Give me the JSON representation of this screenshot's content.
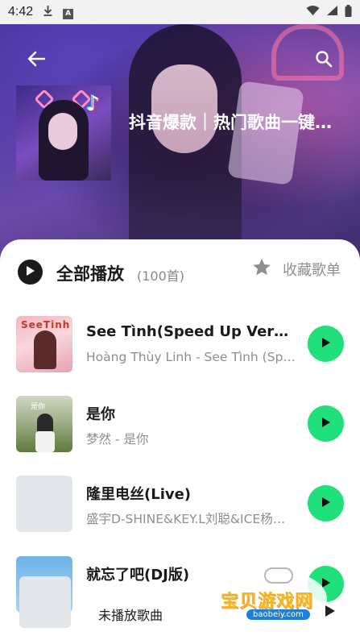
{
  "status_bar": {
    "time": "4:42",
    "icons": [
      "download-icon",
      "a-icon",
      "wifi-icon",
      "signal-icon",
      "battery-icon"
    ]
  },
  "header": {
    "playlist_title": "抖音爆款｜热门歌曲一键…",
    "cover_badge": "♪"
  },
  "actions": {
    "play_all_label": "全部播放",
    "count": "(100首)",
    "favorite_label": "收藏歌单"
  },
  "songs": [
    {
      "title": "See Tình(Speed Up Version)",
      "subtitle": "Hoàng Thùy Linh - See Tình (Spe…",
      "thumb_text": "SeeTinh"
    },
    {
      "title": "是你",
      "subtitle": "梦然 - 是你",
      "thumb_text": "是你"
    },
    {
      "title": "隆里电丝(Live)",
      "subtitle": "盛宇D-SHINE&KEY.L刘聪&ICE杨…"
    },
    {
      "title": "就忘了吧(DJ版)",
      "subtitle": ""
    }
  ],
  "mini_player": {
    "label": "未播放歌曲"
  },
  "watermark": {
    "text": "宝贝游戏网",
    "url": "baobeiy.com"
  },
  "colors": {
    "accent_green": "#1fe07a",
    "hero_purple": "#5b3c9c",
    "muted_text": "#8e8e8e"
  }
}
